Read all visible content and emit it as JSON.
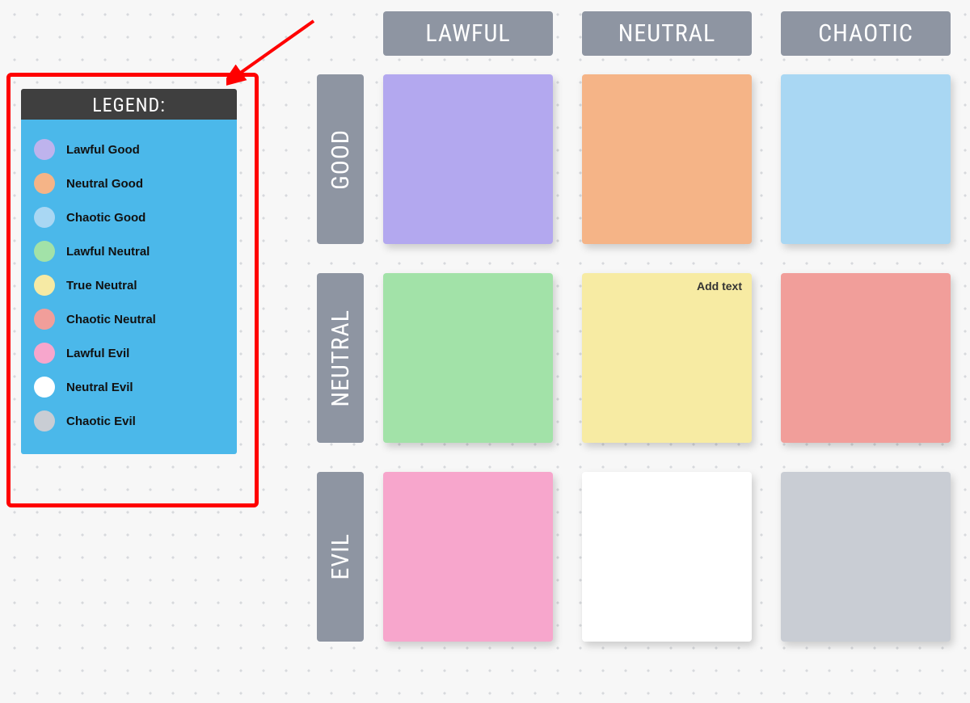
{
  "legend": {
    "title": "LEGEND:",
    "items": [
      {
        "label": "Lawful Good",
        "color": "#beb3ed"
      },
      {
        "label": "Neutral Good",
        "color": "#f5b487"
      },
      {
        "label": "Chaotic Good",
        "color": "#a9d7f3"
      },
      {
        "label": "Lawful Neutral",
        "color": "#a2e2a8"
      },
      {
        "label": "True Neutral",
        "color": "#f6eaa4"
      },
      {
        "label": "Chaotic Neutral",
        "color": "#f19e9a"
      },
      {
        "label": "Lawful Evil",
        "color": "#f7a6cc"
      },
      {
        "label": "Neutral Evil",
        "color": "#ffffff"
      },
      {
        "label": "Chaotic Evil",
        "color": "#c9cdd4"
      }
    ]
  },
  "grid": {
    "columns": [
      "LAWFUL",
      "NEUTRAL",
      "CHAOTIC"
    ],
    "rows": [
      "GOOD",
      "NEUTRAL",
      "EVIL"
    ],
    "cells": [
      [
        {
          "color": "#b3a8ef"
        },
        {
          "color": "#f5b487"
        },
        {
          "color": "#a9d7f3"
        }
      ],
      [
        {
          "color": "#a2e2a8"
        },
        {
          "color": "#f7eba3",
          "add_text": "Add text"
        },
        {
          "color": "#f19e9a"
        }
      ],
      [
        {
          "color": "#f7a6cc"
        },
        {
          "color": "#ffffff"
        },
        {
          "color": "#c9cdd4"
        }
      ]
    ]
  },
  "annotation": {
    "arrow_color": "#ff0000"
  }
}
